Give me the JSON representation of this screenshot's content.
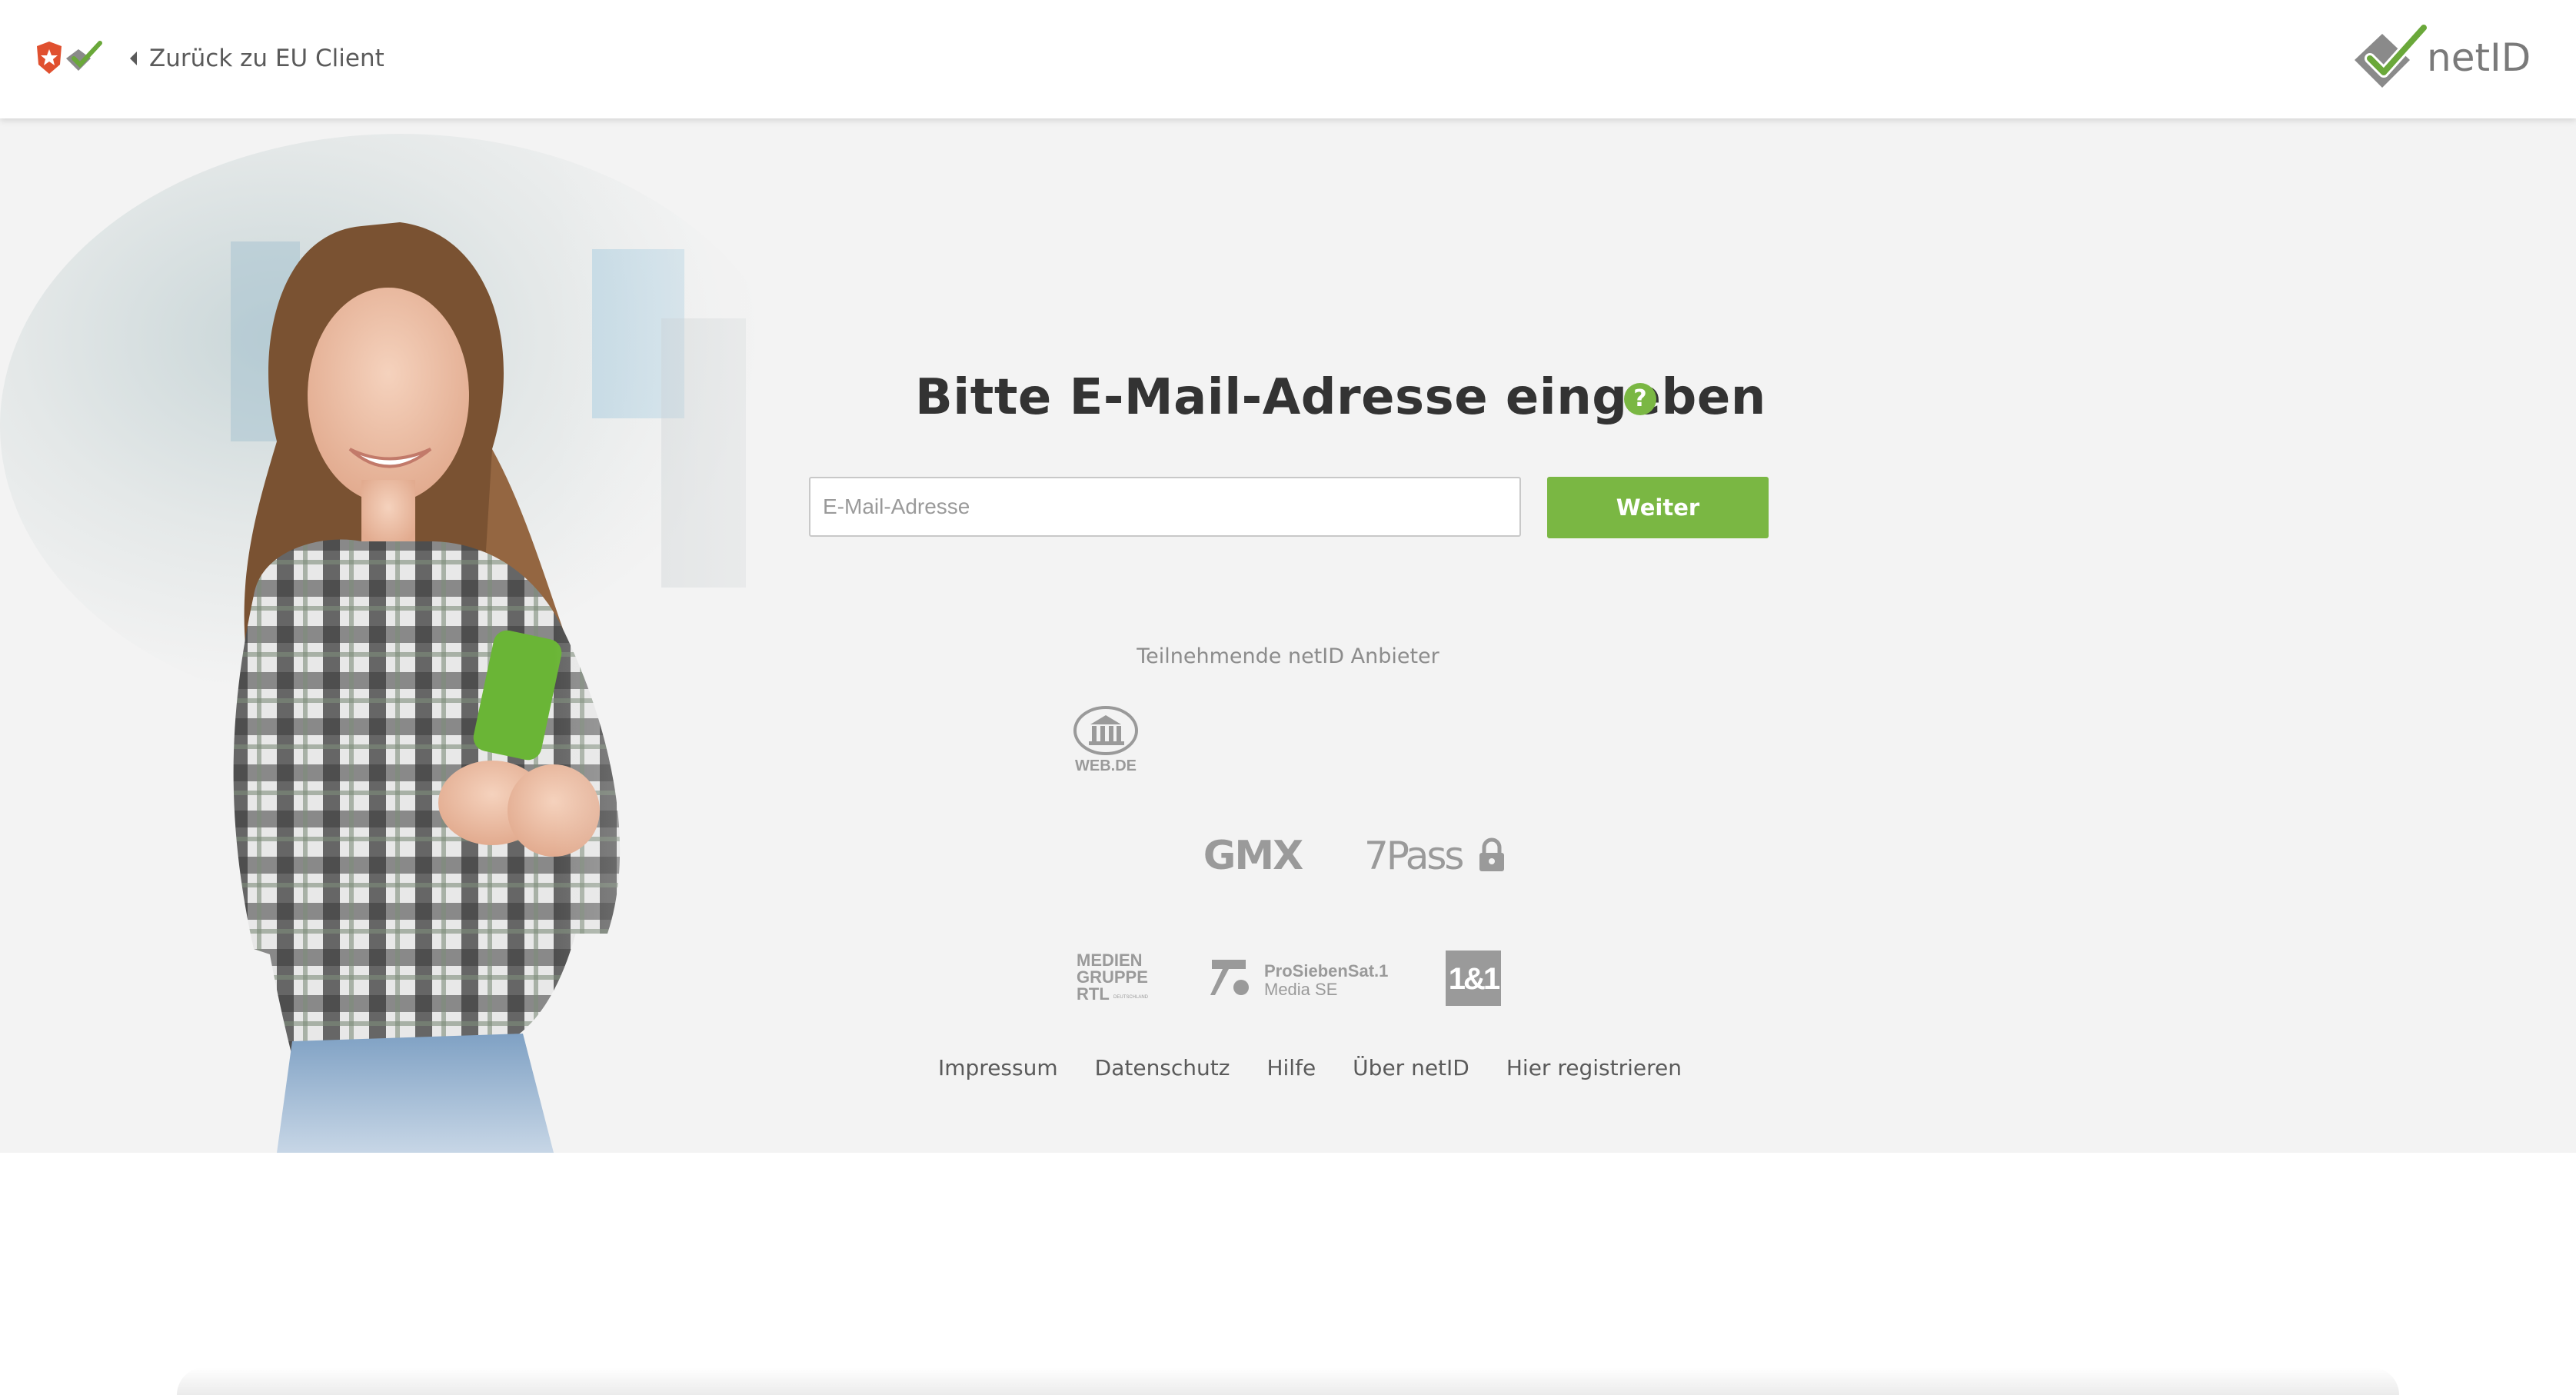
{
  "header": {
    "back_label": "Zurück zu EU Client",
    "brand": "netID"
  },
  "main": {
    "title": "Bitte E-Mail-Adresse eingeben",
    "help_symbol": "?",
    "email_placeholder": "E-Mail-Adresse",
    "email_value": "",
    "submit_label": "Weiter"
  },
  "providers": {
    "heading": "Teilnehmende netID Anbieter",
    "items": [
      {
        "name": "WEB.DE"
      },
      {
        "name": "GMX"
      },
      {
        "name": "7Pass"
      },
      {
        "name_lines": [
          "MEDIEN",
          "GRUPPE",
          "RTL"
        ],
        "sub": "DEUTSCHLAND"
      },
      {
        "name_lines": [
          "ProSiebenSat.1",
          "Media SE"
        ]
      },
      {
        "name": "1&1"
      }
    ]
  },
  "footer": {
    "links": [
      "Impressum",
      "Datenschutz",
      "Hilfe",
      "Über netID",
      "Hier registrieren"
    ]
  },
  "colors": {
    "accent": "#7ab743",
    "text_dark": "#333333",
    "text_muted": "#8c8c8c",
    "logo_gray": "#9a9a9a"
  },
  "icons": [
    "client-logo-icon",
    "chevron-left-icon",
    "help-icon",
    "netid-check-icon"
  ]
}
